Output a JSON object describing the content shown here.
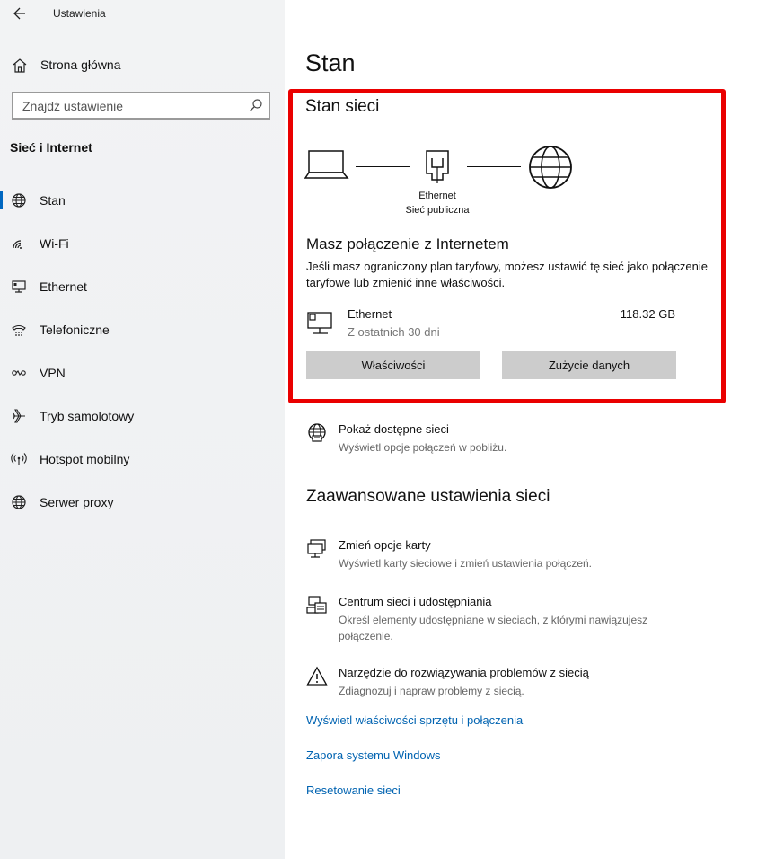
{
  "window": {
    "title": "Ustawienia"
  },
  "sidebar": {
    "home_label": "Strona główna",
    "search_placeholder": "Znajdź ustawienie",
    "section_title": "Sieć i Internet",
    "items": [
      {
        "label": "Stan",
        "icon": "globe-icon",
        "selected": true
      },
      {
        "label": "Wi-Fi",
        "icon": "wifi-icon"
      },
      {
        "label": "Ethernet",
        "icon": "ethernet-icon"
      },
      {
        "label": "Telefoniczne",
        "icon": "dialup-icon"
      },
      {
        "label": "VPN",
        "icon": "vpn-icon"
      },
      {
        "label": "Tryb samolotowy",
        "icon": "airplane-icon"
      },
      {
        "label": "Hotspot mobilny",
        "icon": "hotspot-icon"
      },
      {
        "label": "Serwer proxy",
        "icon": "globe-icon"
      }
    ]
  },
  "main": {
    "title": "Stan",
    "status_card": {
      "title": "Stan sieci",
      "diagram": {
        "adapter_label": "Ethernet",
        "network_label": "Sieć publiczna"
      },
      "connection_title": "Masz połączenie z Internetem",
      "connection_desc": "Jeśli masz ograniczony plan taryfowy, możesz ustawić tę sieć jako połączenie taryfowe lub zmienić inne właściwości.",
      "adapter": {
        "name": "Ethernet",
        "sub": "Z ostatnich 30 dni",
        "amount": "118.32 GB"
      },
      "buttons": {
        "properties": "Właściwości",
        "usage": "Zużycie danych"
      }
    },
    "show_networks": {
      "title": "Pokaż dostępne sieci",
      "desc": "Wyświetl opcje połączeń w pobliżu."
    },
    "advanced_title": "Zaawansowane ustawienia sieci",
    "advanced": [
      {
        "title": "Zmień opcje karty",
        "desc": "Wyświetl karty sieciowe i zmień ustawienia połączeń."
      },
      {
        "title": "Centrum sieci i udostępniania",
        "desc": "Określ elementy udostępniane w sieciach, z którymi nawiązujesz połączenie."
      },
      {
        "title": "Narzędzie do rozwiązywania problemów z siecią",
        "desc": "Zdiagnozuj i napraw problemy z siecią."
      }
    ],
    "links": [
      "Wyświetl właściwości sprzętu i połączenia",
      "Zapora systemu Windows",
      "Resetowanie sieci"
    ]
  },
  "colors": {
    "accent": "#0067c0",
    "link": "#0063b1",
    "highlight_border": "#ea0000",
    "button_bg": "#cccccc"
  }
}
